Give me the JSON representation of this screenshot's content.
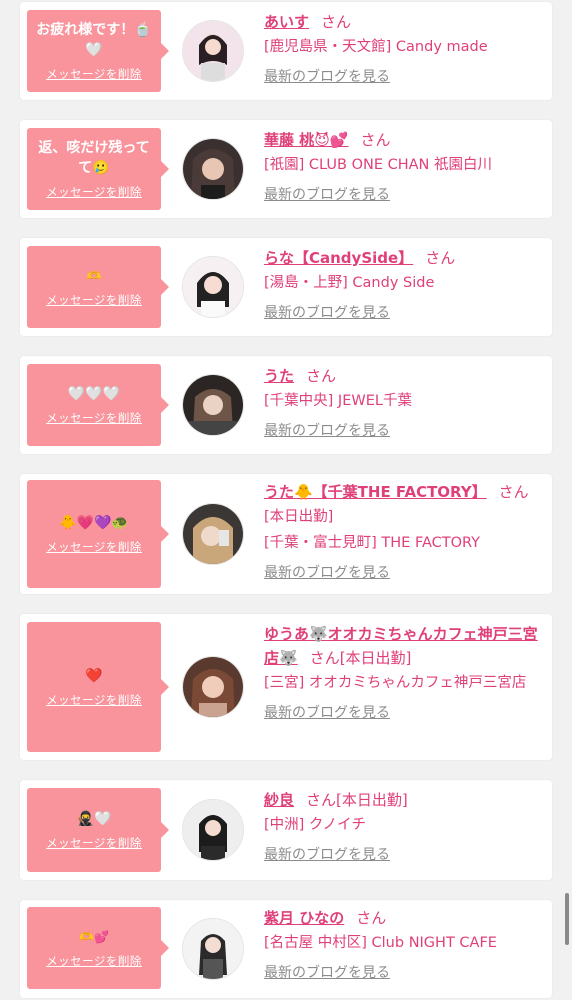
{
  "delete_label": "メッセージを削除",
  "blog_label": "最新のブログを見る",
  "san": "さん",
  "colors": {
    "bubble": "#f9949c",
    "accent": "#e0407a",
    "muted": "#8c8c8c"
  },
  "entries": [
    {
      "message": "お疲れ様です！🍵🤍",
      "name": "あいす",
      "extra": "",
      "shop": "[鹿児島県・天文館] Candy made"
    },
    {
      "message": "返、咳だけ残ってて🥲",
      "name": "華藤 桃😈💕",
      "extra": "",
      "shop": "[祇園] CLUB ONE CHAN 祇園白川"
    },
    {
      "message": "🫶",
      "name": "らな【CandySide】",
      "extra": "",
      "shop": "[湯島・上野] Candy Side"
    },
    {
      "message": "🤍🤍🤍",
      "name": "うた",
      "extra": "",
      "shop": "[千葉中央] JEWEL千葉"
    },
    {
      "message": "🐥💗💜🐢",
      "name": "うた🐥【千葉THE FACTORY】",
      "extra": "",
      "shop_line1": "[本日出勤]",
      "shop": "[千葉・富士見町] THE FACTORY"
    },
    {
      "message": "❤️",
      "name": "ゆうあ🐺オオカミちゃんカフェ神戸三宮店🐺",
      "extra": "[本日出勤]",
      "shop": "[三宮] オオカミちゃんカフェ神戸三宮店"
    },
    {
      "message": "🥷🤍",
      "name": "紗良",
      "extra": "[本日出勤]",
      "shop": "[中洲] クノイチ"
    },
    {
      "message": "🫶💕",
      "name": "紫月 ひなの",
      "extra": "",
      "shop": "[名古屋 中村区] Club NIGHT CAFE"
    }
  ]
}
